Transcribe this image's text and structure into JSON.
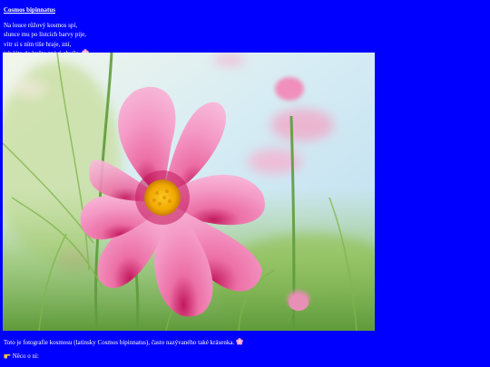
{
  "heading": {
    "title": "Cosmos bipinnatus"
  },
  "poem": {
    "lines": [
      "Na louce růžový kosmos spí,",
      "slunce mu po lístcích barvy pije,",
      "vítr si s ním tiše hraje, zní,",
      "jak léto do květu zpívá chvíle."
    ]
  },
  "photo": {
    "subject": "pink cosmos flower photo"
  },
  "caption": {
    "text": "Toto je fotografie kosmosu (latinsky Cosmos bipinnatus), často nazývaného také krásenka."
  },
  "more": {
    "label": "Něco o ní:"
  },
  "colors": {
    "background": "#0000ff",
    "text": "#ffffff",
    "petal": "#f49ac6",
    "center": "#f4b400"
  }
}
